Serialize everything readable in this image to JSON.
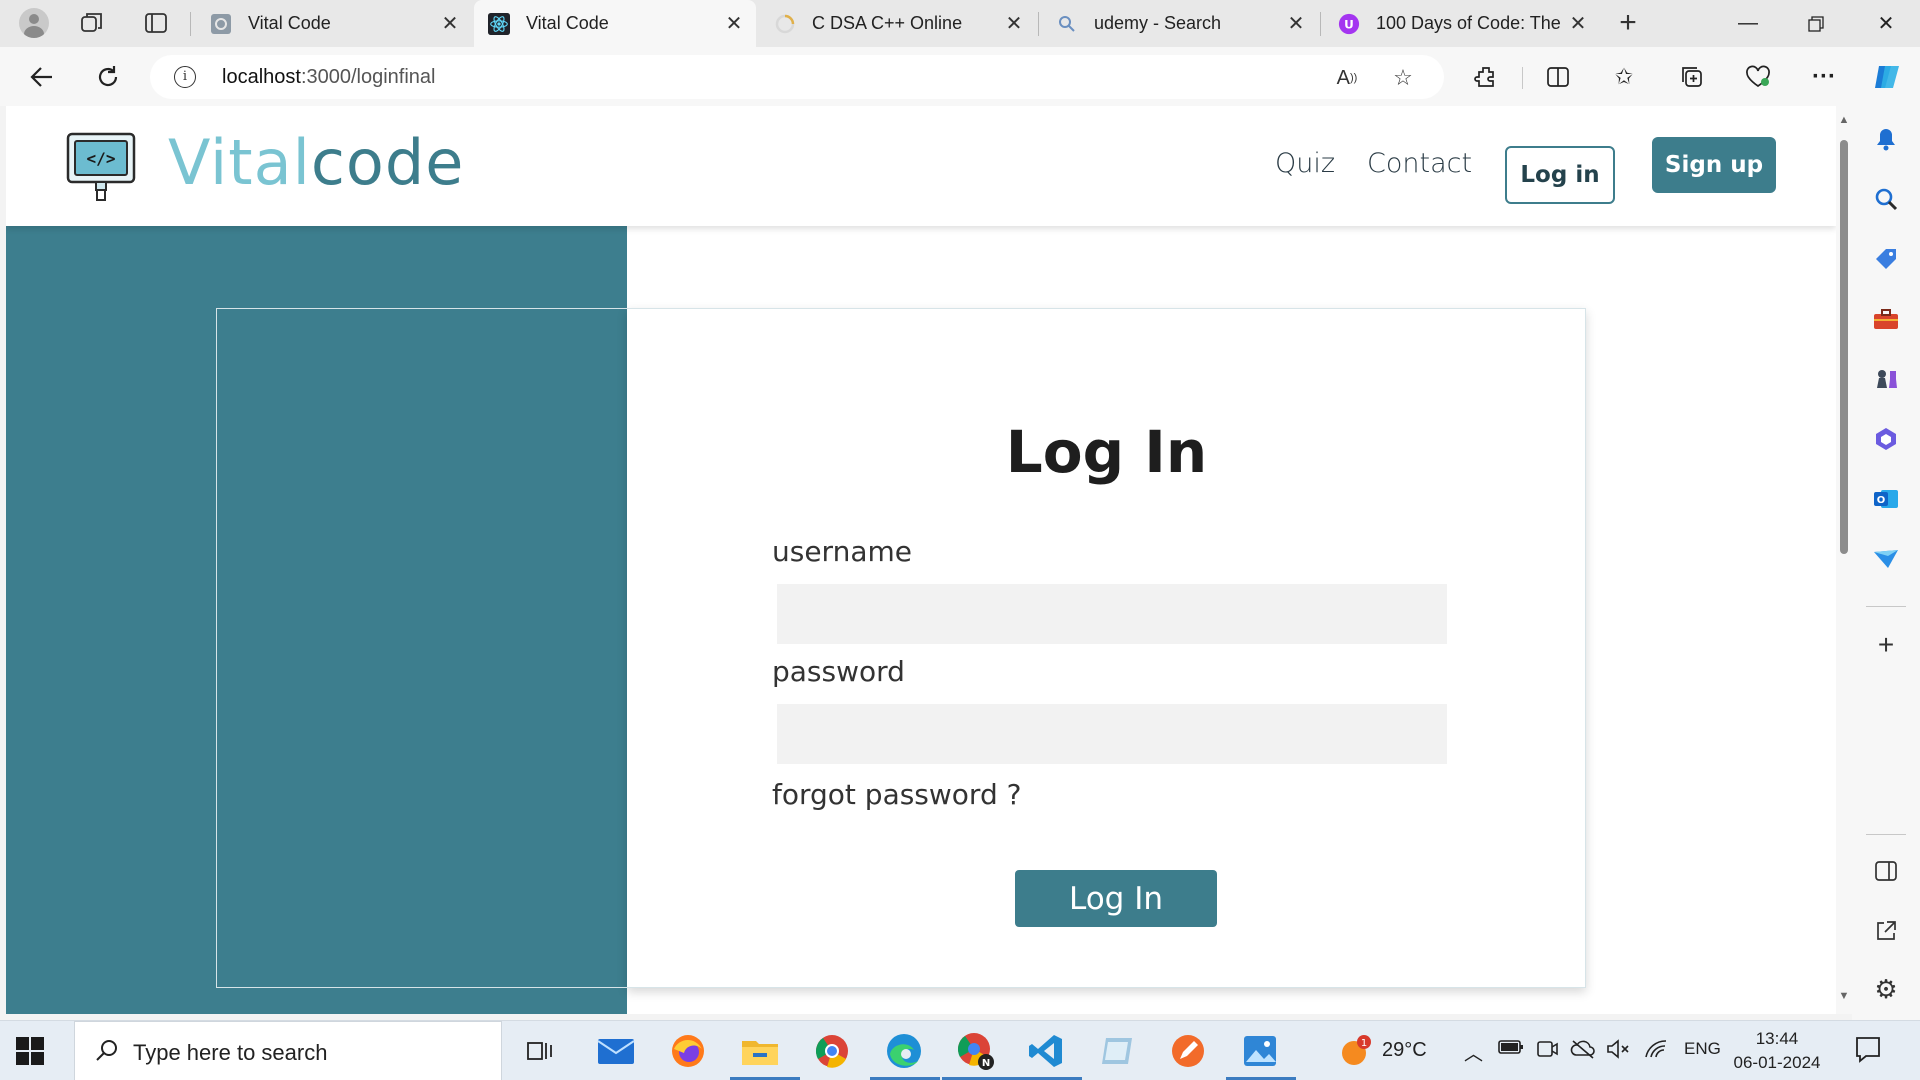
{
  "browser": {
    "tabs": [
      {
        "title": "Vital Code",
        "active": false,
        "icon": "gear-favicon"
      },
      {
        "title": "Vital Code",
        "active": true,
        "icon": "react-favicon"
      },
      {
        "title": "C DSA C++ Online",
        "active": false,
        "icon": "loading-favicon"
      },
      {
        "title": "udemy - Search",
        "active": false,
        "icon": "search-favicon"
      },
      {
        "title": "100 Days of Code: The",
        "active": false,
        "icon": "udemy-favicon"
      }
    ],
    "url_host": "localhost",
    "url_path": ":3000/loginfinal"
  },
  "site": {
    "brand_part1": "Vital",
    "brand_part2": "code",
    "nav": {
      "quiz": "Quiz",
      "contact": "Contact"
    },
    "header_login": "Log in",
    "header_signup": "Sign up",
    "colors": {
      "accent": "#3d7d8c",
      "brand_light": "#7ac4d2",
      "panel": "#3d7e8e"
    }
  },
  "login": {
    "title": "Log In",
    "username_label": "username",
    "username_value": "",
    "password_label": "password",
    "password_value": "",
    "forgot": "forgot password ?",
    "submit": "Log In"
  },
  "taskbar": {
    "search_placeholder": "Type here to search",
    "weather": "29°C",
    "weather_badge": "1",
    "language": "ENG",
    "time": "13:44",
    "date": "06-01-2024"
  }
}
